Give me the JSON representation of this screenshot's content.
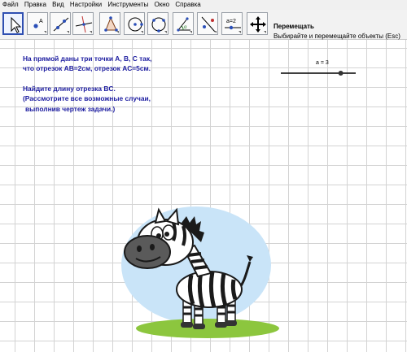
{
  "menu": [
    "Файл",
    "Правка",
    "Вид",
    "Настройки",
    "Инструменты",
    "Окно",
    "Справка"
  ],
  "toolbar": {
    "tools": [
      {
        "name": "move",
        "label": "",
        "active": true
      },
      {
        "name": "point",
        "label": "A"
      },
      {
        "name": "line",
        "label": ""
      },
      {
        "name": "perpendicular-line",
        "label": ""
      },
      {
        "name": "polygon",
        "label": ""
      },
      {
        "name": "circle",
        "label": ""
      },
      {
        "name": "circle-three-points",
        "label": ""
      },
      {
        "name": "angle",
        "label": "α"
      },
      {
        "name": "reflect",
        "label": ""
      },
      {
        "name": "slider",
        "label": "a=2"
      },
      {
        "name": "move-graphics-view",
        "label": ""
      }
    ],
    "selected_title": "Перемещать",
    "selected_description": "Выбирайте и перемещайте объекты (Esc)"
  },
  "problem": {
    "line1": "На прямой даны три точки A, B, C так,",
    "line2": "что отрезок AB=2см, отрезок AC=5см.",
    "line3": "Найдите длину отрезка BC.",
    "line4": "(Рассмотрите все возможные случаи,",
    "line5": "выполнив чертеж задачи.)"
  },
  "slider": {
    "label": "a = 3",
    "value": 3,
    "min": -5,
    "max": 5
  },
  "colors": {
    "text": "#1c1ca0",
    "active_border": "#2f4fb1",
    "grid": "#d3d3d3",
    "sky": "#c9e4f8",
    "grass": "#8cc63e"
  },
  "image": {
    "name": "zebra-illustration"
  }
}
